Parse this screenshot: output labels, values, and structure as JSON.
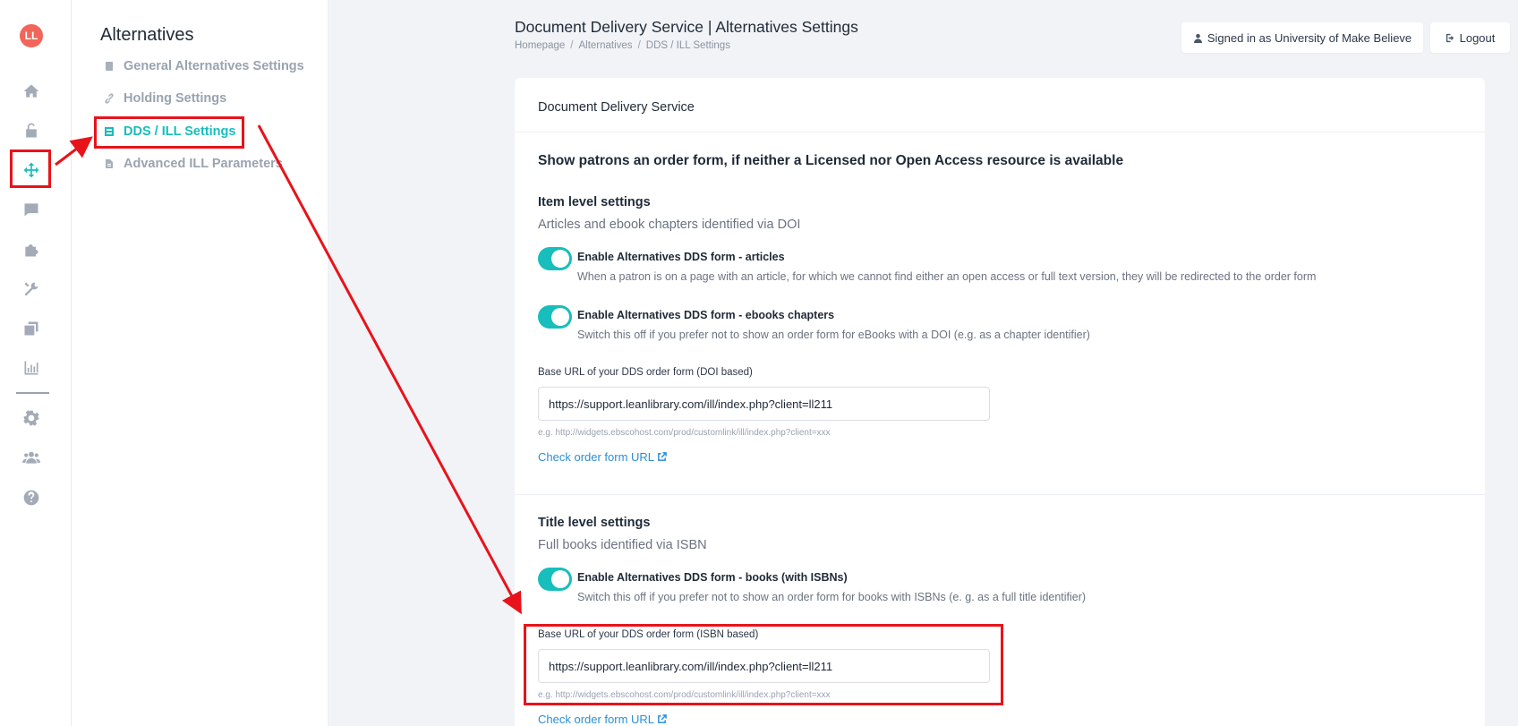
{
  "app": {
    "logo_text": "LL"
  },
  "rail": {
    "items": [
      {
        "icon": "home-icon"
      },
      {
        "icon": "unlock-icon"
      },
      {
        "icon": "move-arrows-icon",
        "active": true
      },
      {
        "icon": "chat-bubble-icon"
      },
      {
        "icon": "puzzle-icon"
      },
      {
        "icon": "tools-icon"
      },
      {
        "icon": "copy-icon"
      },
      {
        "icon": "bar-chart-icon"
      },
      {
        "icon": "gear-icon"
      },
      {
        "icon": "users-icon"
      },
      {
        "icon": "help-icon"
      }
    ]
  },
  "subnav": {
    "title": "Alternatives",
    "items": [
      {
        "label": "General Alternatives Settings",
        "icon": "book-icon"
      },
      {
        "label": "Holding Settings",
        "icon": "link-icon"
      },
      {
        "label": "DDS / ILL Settings",
        "icon": "form-icon",
        "active": true
      },
      {
        "label": "Advanced ILL Parameters",
        "icon": "file-icon"
      }
    ]
  },
  "header": {
    "title": "Document Delivery Service | Alternatives Settings",
    "breadcrumb": [
      "Homepage",
      "Alternatives",
      "DDS / ILL Settings"
    ],
    "signed_in_label": "Signed in as University of Make Believe",
    "logout_label": "Logout"
  },
  "card": {
    "header": "Document Delivery Service",
    "headline": "Show patrons an order form, if neither a Licensed nor Open Access resource is available",
    "item_level": {
      "title": "Item level settings",
      "subtitle": "Articles and ebook chapters identified via DOI",
      "toggles": [
        {
          "label": "Enable Alternatives DDS form - articles",
          "desc": "When a patron is on a page with an article, for which we cannot find either an open access or full text version, they will be redirected to the order form",
          "on": true
        },
        {
          "label": "Enable Alternatives DDS form - ebooks chapters",
          "desc": "Switch this off if you prefer not to show an order form for eBooks with a DOI (e.g. as a chapter identifier)",
          "on": true
        }
      ],
      "field_label": "Base URL of your DDS order form (DOI based)",
      "field_value": "https://support.leanlibrary.com/ill/index.php?client=ll211",
      "field_hint": "e.g. http://widgets.ebscohost.com/prod/customlink/ill/index.php?client=xxx",
      "check_link": "Check order form URL"
    },
    "title_level": {
      "title": "Title level settings",
      "subtitle": "Full books identified via ISBN",
      "toggles": [
        {
          "label": "Enable Alternatives DDS form - books (with ISBNs)",
          "desc": "Switch this off if you prefer not to show an order form for books with ISBNs (e. g. as a full title identifier)",
          "on": true
        }
      ],
      "field_label": "Base URL of your DDS order form (ISBN based)",
      "field_value": "https://support.leanlibrary.com/ill/index.php?client=ll211",
      "field_hint": "e.g. http://widgets.ebscohost.com/prod/customlink/ill/index.php?client=xxx",
      "check_link": "Check order form URL"
    }
  },
  "colors": {
    "accent": "#17bebb",
    "annotation": "#e8131a",
    "link": "#2b8fd6",
    "logo": "#f2655a"
  }
}
